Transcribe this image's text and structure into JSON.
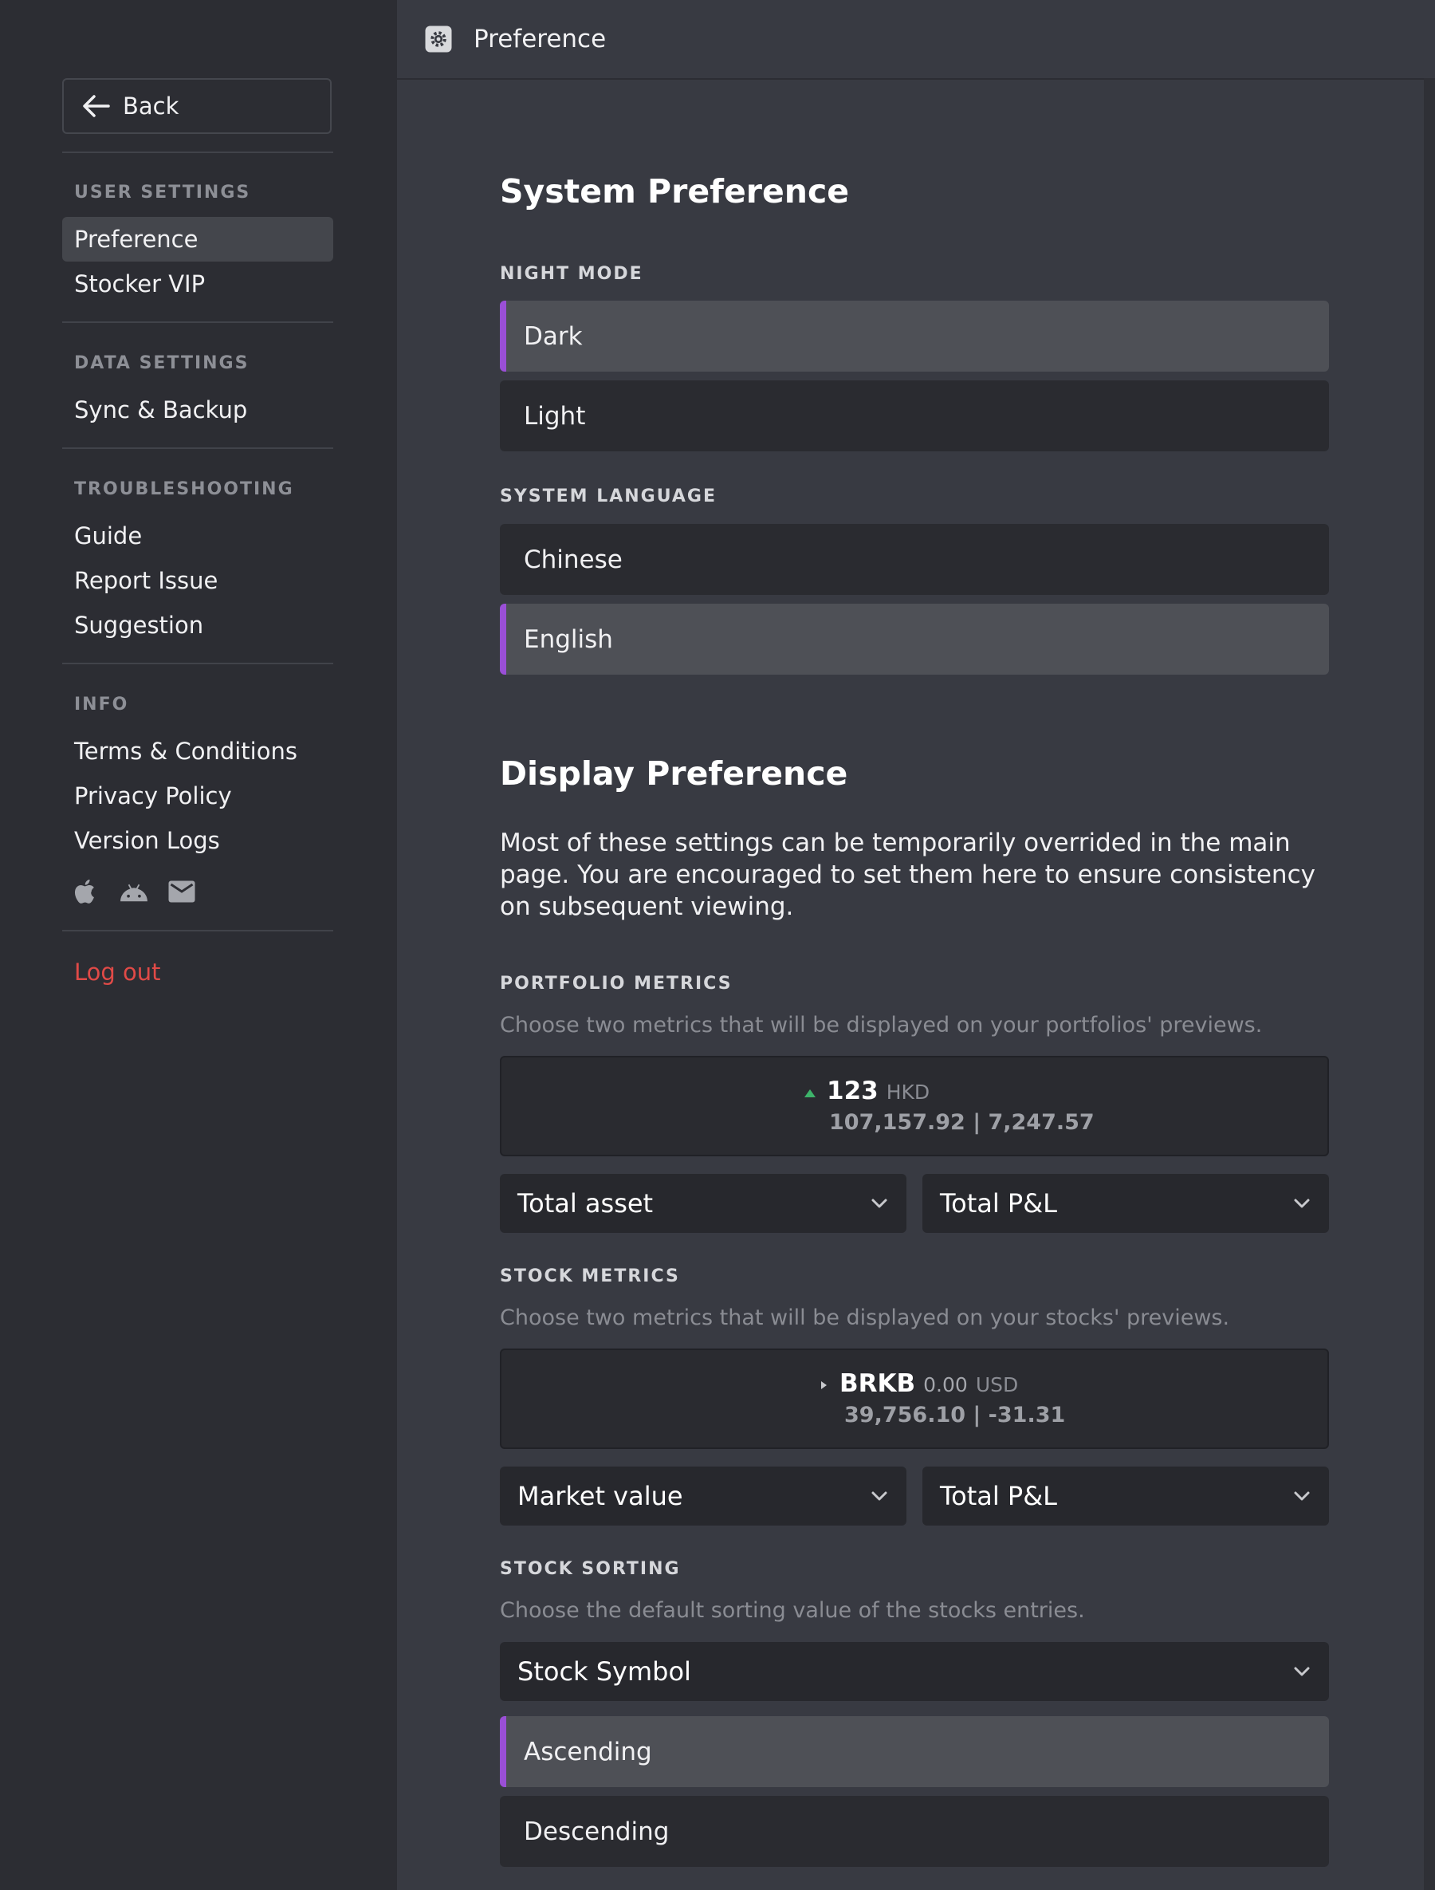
{
  "sidebar": {
    "back_label": "Back",
    "sections": [
      {
        "title": "USER SETTINGS",
        "items": [
          "Preference",
          "Stocker VIP"
        ]
      },
      {
        "title": "DATA SETTINGS",
        "items": [
          "Sync & Backup"
        ]
      },
      {
        "title": "TROUBLESHOOTING",
        "items": [
          "Guide",
          "Report Issue",
          "Suggestion"
        ]
      },
      {
        "title": "INFO",
        "items": [
          "Terms & Conditions",
          "Privacy Policy",
          "Version Logs"
        ]
      }
    ],
    "active_item": "Preference",
    "social_icons": [
      "apple-icon",
      "android-icon",
      "mail-icon"
    ],
    "logout_label": "Log out"
  },
  "header": {
    "title": "Preference",
    "icon": "gear-icon"
  },
  "system_preference": {
    "title": "System Preference",
    "night_mode": {
      "label": "NIGHT MODE",
      "options": [
        "Dark",
        "Light"
      ],
      "selected": "Dark"
    },
    "language": {
      "label": "SYSTEM LANGUAGE",
      "options": [
        "Chinese",
        "English"
      ],
      "selected": "English"
    }
  },
  "display_preference": {
    "title": "Display Preference",
    "description": "Most of these settings can be temporarily overrided in the main page. You are encouraged to set them here to ensure consistency on subsequent viewing.",
    "portfolio_metrics": {
      "label": "PORTFOLIO METRICS",
      "hint": "Choose two metrics that will be displayed on your portfolios' previews.",
      "preview": {
        "name": "123",
        "currency": "HKD",
        "values": "107,157.92 | 7,247.57"
      },
      "metric1": "Total asset",
      "metric2": "Total P&L"
    },
    "stock_metrics": {
      "label": "STOCK METRICS",
      "hint": "Choose two metrics that will be displayed on your stocks' previews.",
      "preview": {
        "symbol": "BRKB",
        "change": "0.00",
        "currency": "USD",
        "values": "39,756.10 | -31.31"
      },
      "metric1": "Market value",
      "metric2": "Total P&L"
    },
    "stock_sorting": {
      "label": "STOCK SORTING",
      "hint": "Choose the default sorting value of the stocks entries.",
      "sort_by": "Stock Symbol",
      "order_options": [
        "Ascending",
        "Descending"
      ],
      "selected_order": "Ascending"
    }
  },
  "colors": {
    "accent": "#9a4fd6",
    "logout": "#e04a47",
    "up": "#3db36a"
  }
}
